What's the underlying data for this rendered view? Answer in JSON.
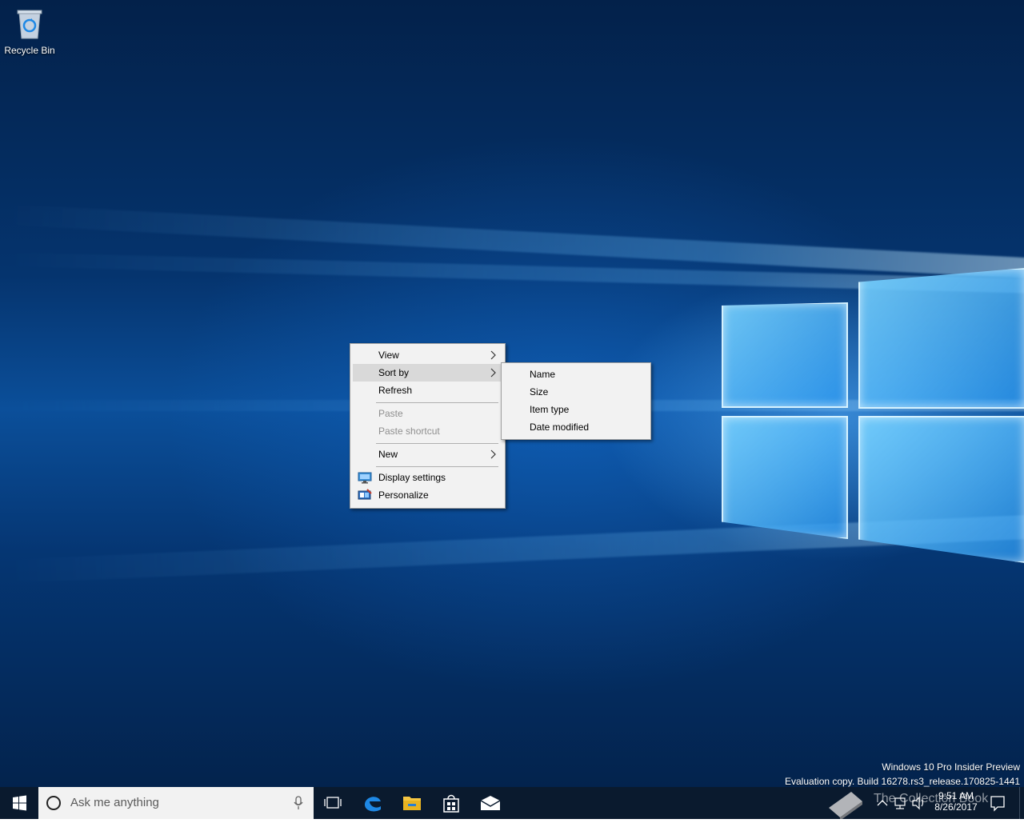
{
  "desktop": {
    "icons": [
      {
        "label": "Recycle Bin",
        "icon": "recycle-bin-icon"
      }
    ],
    "watermark": {
      "line1": "Windows 10 Pro Insider Preview",
      "line2": "Evaluation copy. Build 16278.rs3_release.170825-1441"
    }
  },
  "context_menu": {
    "items": [
      {
        "label": "View",
        "has_submenu": true
      },
      {
        "label": "Sort by",
        "has_submenu": true,
        "highlighted": true
      },
      {
        "label": "Refresh"
      },
      {
        "label": "Paste",
        "disabled": true
      },
      {
        "label": "Paste shortcut",
        "disabled": true
      },
      {
        "label": "New",
        "has_submenu": true
      },
      {
        "label": "Display settings",
        "icon": "display-settings-icon"
      },
      {
        "label": "Personalize",
        "icon": "personalize-icon"
      }
    ]
  },
  "sortby_submenu": {
    "items": [
      {
        "label": "Name"
      },
      {
        "label": "Size"
      },
      {
        "label": "Item type"
      },
      {
        "label": "Date modified"
      }
    ]
  },
  "taskbar": {
    "search_placeholder": "Ask me anything",
    "pinned": [
      "task-view-icon",
      "edge-icon",
      "file-explorer-icon",
      "store-icon",
      "mail-icon"
    ],
    "tray": {
      "time": "9:51 AM",
      "date": "8/26/2017",
      "overlay_text": "The Collection Book"
    }
  },
  "colors": {
    "taskbar": "#0a1a2e",
    "menu_bg": "#f2f2f2",
    "menu_hover": "#d9d9d9",
    "disabled_text": "#8f8f8f"
  }
}
